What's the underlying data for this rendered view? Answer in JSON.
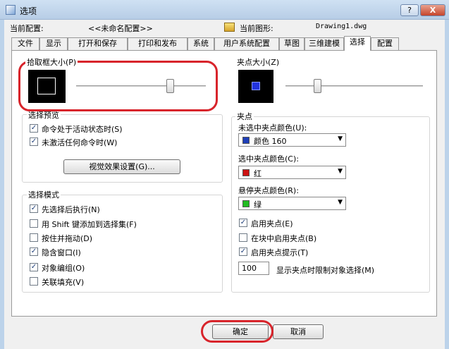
{
  "window": {
    "title": "选项",
    "help": "?",
    "close": "X"
  },
  "header": {
    "current_config_label": "当前配置:",
    "current_config_value": "<<未命名配置>>",
    "current_drawing_label": "当前图形:",
    "current_drawing_value": "Drawing1.dwg"
  },
  "tabs": [
    "文件",
    "显示",
    "打开和保存",
    "打印和发布",
    "系统",
    "用户系统配置",
    "草图",
    "三维建模",
    "选择",
    "配置"
  ],
  "active_tab": "选择",
  "pickbox": {
    "title": "拾取框大小(P)",
    "level": 0.74
  },
  "grip_size": {
    "title": "夹点大小(Z)",
    "level": 0.22
  },
  "selection_preview": {
    "title": "选择预览",
    "items": [
      {
        "label": "命令处于活动状态时(S)",
        "checked": true
      },
      {
        "label": "未激活任何命令时(W)",
        "checked": true
      }
    ],
    "visual_effects_button": "视觉效果设置(G)..."
  },
  "selection_mode": {
    "title": "选择模式",
    "items": [
      {
        "label": "先选择后执行(N)",
        "checked": true
      },
      {
        "label": "用 Shift 键添加到选择集(F)",
        "checked": false
      },
      {
        "label": "按住并拖动(D)",
        "checked": false
      },
      {
        "label": "隐含窗口(I)",
        "checked": true
      },
      {
        "label": "对象编组(O)",
        "checked": true
      },
      {
        "label": "关联填充(V)",
        "checked": false
      }
    ]
  },
  "grips": {
    "title": "夹点",
    "unselected_label": "未选中夹点颜色(U):",
    "unselected_value": "颜色 160",
    "unselected_color": "#1f3fb8",
    "selected_label": "选中夹点颜色(C):",
    "selected_value": "红",
    "selected_color": "#cc1111",
    "hover_label": "悬停夹点颜色(R):",
    "hover_value": "绿",
    "hover_color": "#22bb22",
    "enable_grips": {
      "label": "启用夹点(E)",
      "checked": true
    },
    "enable_block_grips": {
      "label": "在块中启用夹点(B)",
      "checked": false
    },
    "enable_grip_tips": {
      "label": "启用夹点提示(T)",
      "checked": true
    },
    "limit_value": "100",
    "limit_label": "显示夹点时限制对象选择(M)"
  },
  "buttons": {
    "ok": "确定",
    "cancel": "取消"
  }
}
